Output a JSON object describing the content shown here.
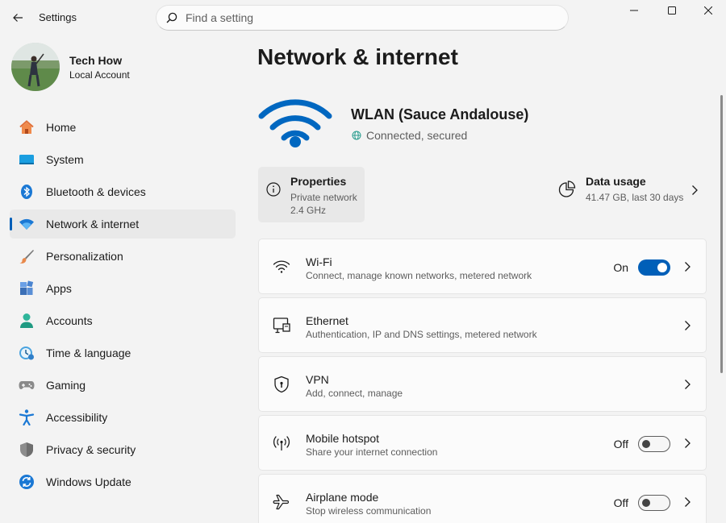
{
  "window": {
    "title": "Settings"
  },
  "search": {
    "placeholder": "Find a setting"
  },
  "profile": {
    "name": "Tech How",
    "account_type": "Local Account"
  },
  "sidebar": {
    "items": [
      {
        "label": "Home",
        "icon": "home-icon"
      },
      {
        "label": "System",
        "icon": "system-icon"
      },
      {
        "label": "Bluetooth & devices",
        "icon": "bluetooth-icon"
      },
      {
        "label": "Network & internet",
        "icon": "network-icon",
        "active": true
      },
      {
        "label": "Personalization",
        "icon": "brush-icon"
      },
      {
        "label": "Apps",
        "icon": "apps-icon"
      },
      {
        "label": "Accounts",
        "icon": "person-icon"
      },
      {
        "label": "Time & language",
        "icon": "clock-globe-icon"
      },
      {
        "label": "Gaming",
        "icon": "gamepad-icon"
      },
      {
        "label": "Accessibility",
        "icon": "accessibility-icon"
      },
      {
        "label": "Privacy & security",
        "icon": "shield-icon"
      },
      {
        "label": "Windows Update",
        "icon": "refresh-icon"
      }
    ]
  },
  "main": {
    "title": "Network & internet",
    "connection": {
      "name": "WLAN (Sauce Andalouse)",
      "status": "Connected, secured"
    },
    "properties": {
      "title": "Properties",
      "network_type": "Private network",
      "band": "2.4 GHz"
    },
    "data_usage": {
      "title": "Data usage",
      "summary": "41.47 GB, last 30 days"
    },
    "cards": [
      {
        "title": "Wi-Fi",
        "subtitle": "Connect, manage known networks, metered network",
        "icon": "wifi-icon",
        "state": "On",
        "toggle_on": true
      },
      {
        "title": "Ethernet",
        "subtitle": "Authentication, IP and DNS settings, metered network",
        "icon": "ethernet-icon"
      },
      {
        "title": "VPN",
        "subtitle": "Add, connect, manage",
        "icon": "vpn-shield-icon"
      },
      {
        "title": "Mobile hotspot",
        "subtitle": "Share your internet connection",
        "icon": "hotspot-icon",
        "state": "Off",
        "toggle_on": false
      },
      {
        "title": "Airplane mode",
        "subtitle": "Stop wireless communication",
        "icon": "airplane-icon",
        "state": "Off",
        "toggle_on": false
      }
    ]
  },
  "colors": {
    "accent": "#005fb8",
    "wifi_blue": "#0067c0"
  }
}
